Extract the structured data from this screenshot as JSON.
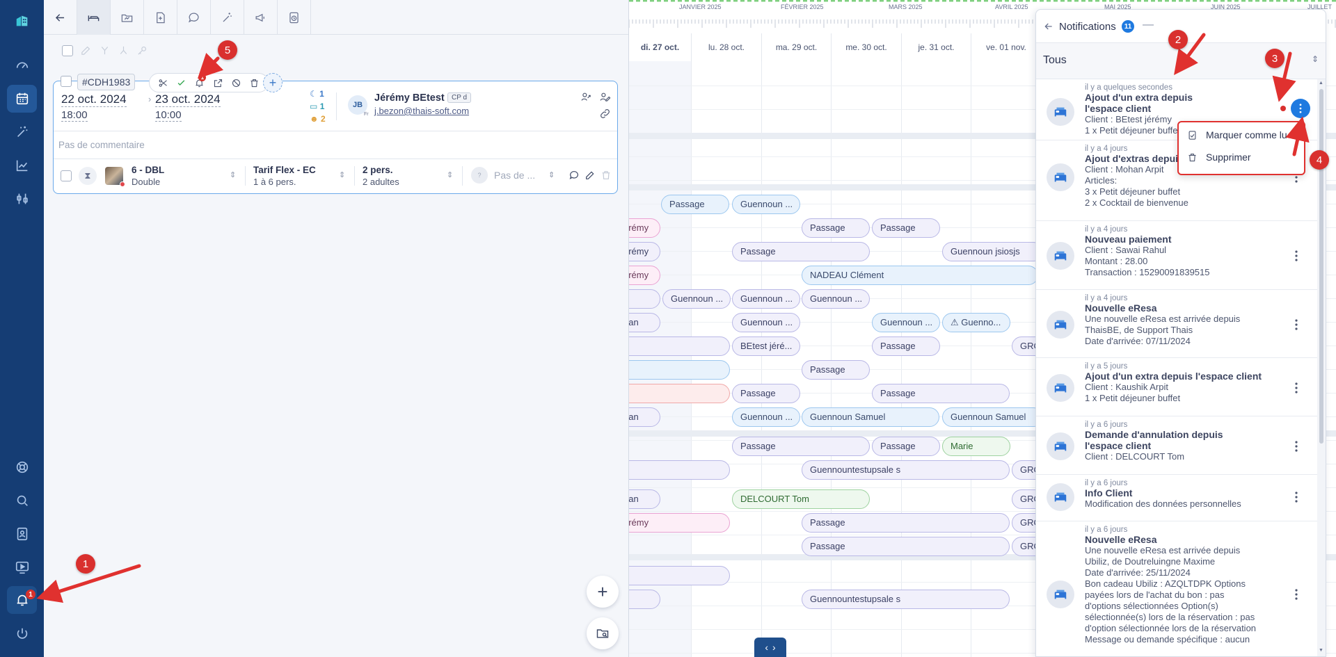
{
  "rail": {
    "bell_badge": "1",
    "items": [
      "logo",
      "dashboard",
      "calendar",
      "magic",
      "statistics",
      "settings",
      "help",
      "search",
      "contacts",
      "screen",
      "notifications",
      "power"
    ]
  },
  "toolbar": {
    "tabs": [
      "back",
      "bed",
      "folder",
      "document",
      "comment",
      "magic",
      "megaphone",
      "history"
    ]
  },
  "booking": {
    "ref": "#CDH1983",
    "alert_count": "1",
    "arrival_date": "22 oct. 2024",
    "arrival_time": "18:00",
    "departure_date": "23 oct. 2024",
    "departure_time": "10:00",
    "nights": "1",
    "rooms": "1",
    "guests": "2",
    "client_initials": "JB",
    "client_lang": "Fr",
    "client_name": "Jérémy BEtest",
    "client_tag": "CP d",
    "client_email": "j.bezon@thais-soft.com",
    "comment_placeholder": "Pas de commentaire",
    "room_name": "6 - DBL",
    "room_type": "Double",
    "rate_name": "Tarif Flex - EC",
    "rate_sub": "1 à 6 pers.",
    "pax": "2 pers.",
    "pax_sub": "2 adultes",
    "guest_placeholder": "Pas de ...",
    "guest_initial": "?"
  },
  "calendar": {
    "months": [
      "JANVIER 2025",
      "FÉVRIER 2025",
      "MARS 2025",
      "AVRIL 2025",
      "MAI 2025",
      "JUIN 2025",
      "JUILLET"
    ],
    "days": [
      "di. 27 oct.",
      "lu. 28 oct.",
      "ma. 29 oct.",
      "me. 30 oct.",
      "je. 31 oct.",
      "ve. 01 nov."
    ],
    "bookings": [
      {
        "label": "Passage",
        "style": "blue"
      },
      {
        "label": "Guennoun ...",
        "style": "blue"
      },
      {
        "label": "érémy",
        "style": "pink"
      },
      {
        "label": "Passage",
        "style": ""
      },
      {
        "label": "Passage",
        "style": ""
      },
      {
        "label": "érémy",
        "style": ""
      },
      {
        "label": "Passage",
        "style": ""
      },
      {
        "label": "Guennoun jsiosjs",
        "style": ""
      },
      {
        "label": "érémy",
        "style": "pink"
      },
      {
        "label": "NADEAU Clément",
        "style": "blue"
      },
      {
        "label": "",
        "style": ""
      },
      {
        "label": "Guennoun ...",
        "style": ""
      },
      {
        "label": "Guennoun ...",
        "style": ""
      },
      {
        "label": "Guennoun ...",
        "style": ""
      },
      {
        "label": "han",
        "style": ""
      },
      {
        "label": "Guennoun ...",
        "style": ""
      },
      {
        "label": "Guennoun ...",
        "style": "blue"
      },
      {
        "label": "⚠ Guenno...",
        "style": "blue"
      },
      {
        "label": "",
        "style": ""
      },
      {
        "label": "BEtest jéré...",
        "style": ""
      },
      {
        "label": "Passage",
        "style": ""
      },
      {
        "label": "GRO",
        "style": ""
      },
      {
        "label": "",
        "style": "blue"
      },
      {
        "label": "Passage",
        "style": ""
      },
      {
        "label": "",
        "style": "red"
      },
      {
        "label": "Passage",
        "style": ""
      },
      {
        "label": "Passage",
        "style": ""
      },
      {
        "label": "han",
        "style": ""
      },
      {
        "label": "Guennoun ...",
        "style": "blue"
      },
      {
        "label": "Guennoun Samuel",
        "style": "blue"
      },
      {
        "label": "Guennoun Samuel",
        "style": "blue"
      },
      {
        "label": "Passage",
        "style": ""
      },
      {
        "label": "Passage",
        "style": ""
      },
      {
        "label": "Marie",
        "style": "green"
      },
      {
        "label": "",
        "style": ""
      },
      {
        "label": "Guennountestupsale s",
        "style": ""
      },
      {
        "label": "GRO",
        "style": ""
      },
      {
        "label": "han",
        "style": ""
      },
      {
        "label": "DELCOURT Tom",
        "style": "green"
      },
      {
        "label": "GRO",
        "style": ""
      },
      {
        "label": "érémy",
        "style": "pink"
      },
      {
        "label": "Passage",
        "style": ""
      },
      {
        "label": "GRO",
        "style": ""
      },
      {
        "label": "Passage",
        "style": ""
      },
      {
        "label": "GRO",
        "style": ""
      },
      {
        "label": "",
        "style": ""
      },
      {
        "label": "",
        "style": ""
      },
      {
        "label": "Guennountestupsale s",
        "style": ""
      }
    ]
  },
  "notifications": {
    "title": "Notifications",
    "count": "11",
    "filter": "Tous",
    "context_menu": {
      "mark_read": "Marquer comme lu",
      "delete": "Supprimer"
    },
    "items": [
      {
        "time": "il y a quelques secondes",
        "title": "Ajout d'un extra depuis l'espace client",
        "title_lines": [
          "Ajout d'un extra depuis",
          "l'espace client"
        ],
        "lines": [
          "Client : BEtest jérémy",
          "1 x Petit déjeuner buffet"
        ],
        "unread": true
      },
      {
        "time": "il y a 4 jours",
        "title_lines": [
          "Ajout d'extras depuis l'espace client"
        ],
        "lines": [
          "Client : Mohan Arpit",
          "Articles:",
          "3 x Petit déjeuner buffet",
          "2 x Cocktail de bienvenue"
        ]
      },
      {
        "time": "il y a 4 jours",
        "title_lines": [
          "Nouveau paiement"
        ],
        "lines": [
          "Client : Sawai Rahul",
          "Montant : 28.00",
          "Transaction : 15290091839515"
        ]
      },
      {
        "time": "il y a 4 jours",
        "title_lines": [
          "Nouvelle eResa"
        ],
        "lines": [
          "Une nouvelle eResa est arrivée depuis",
          "ThaisBE, de Support Thais",
          "Date d'arrivée: 07/11/2024"
        ]
      },
      {
        "time": "il y a 5 jours",
        "title_lines": [
          "Ajout d'un extra depuis l'espace client"
        ],
        "lines": [
          "Client : Kaushik Arpit",
          "1 x Petit déjeuner buffet"
        ]
      },
      {
        "time": "il y a 6 jours",
        "title_lines": [
          "Demande d'annulation depuis",
          "l'espace client"
        ],
        "lines": [
          "Client : DELCOURT Tom"
        ]
      },
      {
        "time": "il y a 6 jours",
        "title_lines": [
          "Info Client"
        ],
        "lines": [
          "Modification des données personnelles"
        ]
      },
      {
        "time": "il y a 6 jours",
        "title_lines": [
          "Nouvelle eResa"
        ],
        "lines": [
          "Une nouvelle eResa est arrivée depuis",
          "Ubiliz, de Doutreluingne Maxime",
          "Date d'arrivée: 25/11/2024",
          "Bon cadeau Ubiliz : AZQLTDPK Options",
          "payées lors de l'achat du bon : pas",
          "d'options sélectionnées Option(s)",
          "sélectionnée(s) lors de la réservation : pas",
          "d'option sélectionnée lors de la réservation",
          "Message ou demande spécifique : aucun"
        ]
      }
    ]
  },
  "annotations": [
    "1",
    "2",
    "3",
    "4",
    "5"
  ],
  "colors": {
    "rail": "#153d74",
    "accent": "#1f7ae0",
    "annotation": "#d9302e"
  }
}
